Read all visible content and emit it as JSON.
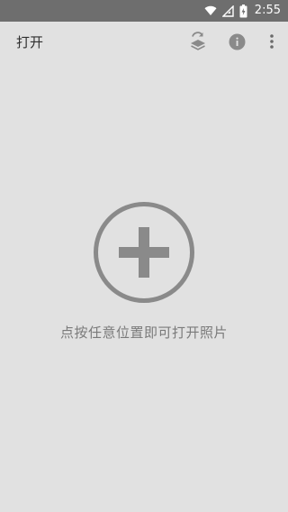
{
  "status_bar": {
    "time": "2:55",
    "icons": [
      "wifi-icon",
      "signal-icon",
      "battery-icon"
    ]
  },
  "toolbar": {
    "title": "打开",
    "actions": [
      "layers-swap-icon",
      "info-icon",
      "more-vert-icon"
    ]
  },
  "main": {
    "add_icon": "add-circle-icon",
    "hint": "点按任意位置即可打开照片"
  },
  "colors": {
    "background": "#e1e1e1",
    "status_bar": "#6e6e6e",
    "icon_gray": "#8a8a8a"
  }
}
